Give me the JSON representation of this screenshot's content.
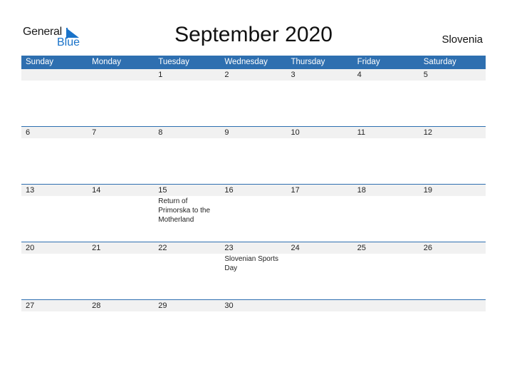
{
  "logo": {
    "line1": "General",
    "line2": "Blue"
  },
  "title": "September 2020",
  "country": "Slovenia",
  "weekdays": [
    "Sunday",
    "Monday",
    "Tuesday",
    "Wednesday",
    "Thursday",
    "Friday",
    "Saturday"
  ],
  "weeks": [
    {
      "days": [
        "",
        "",
        "1",
        "2",
        "3",
        "4",
        "5"
      ],
      "events": [
        "",
        "",
        "",
        "",
        "",
        "",
        ""
      ]
    },
    {
      "days": [
        "6",
        "7",
        "8",
        "9",
        "10",
        "11",
        "12"
      ],
      "events": [
        "",
        "",
        "",
        "",
        "",
        "",
        ""
      ]
    },
    {
      "days": [
        "13",
        "14",
        "15",
        "16",
        "17",
        "18",
        "19"
      ],
      "events": [
        "",
        "",
        "Return of Primorska to the Motherland",
        "",
        "",
        "",
        ""
      ]
    },
    {
      "days": [
        "20",
        "21",
        "22",
        "23",
        "24",
        "25",
        "26"
      ],
      "events": [
        "",
        "",
        "",
        "Slovenian Sports Day",
        "",
        "",
        ""
      ]
    },
    {
      "days": [
        "27",
        "28",
        "29",
        "30",
        "",
        "",
        ""
      ],
      "events": [
        "",
        "",
        "",
        "",
        "",
        "",
        ""
      ]
    }
  ],
  "colors": {
    "header_bg": "#2e6fb0",
    "brand_blue": "#1a73c9",
    "date_row_bg": "#f1f1f1"
  }
}
